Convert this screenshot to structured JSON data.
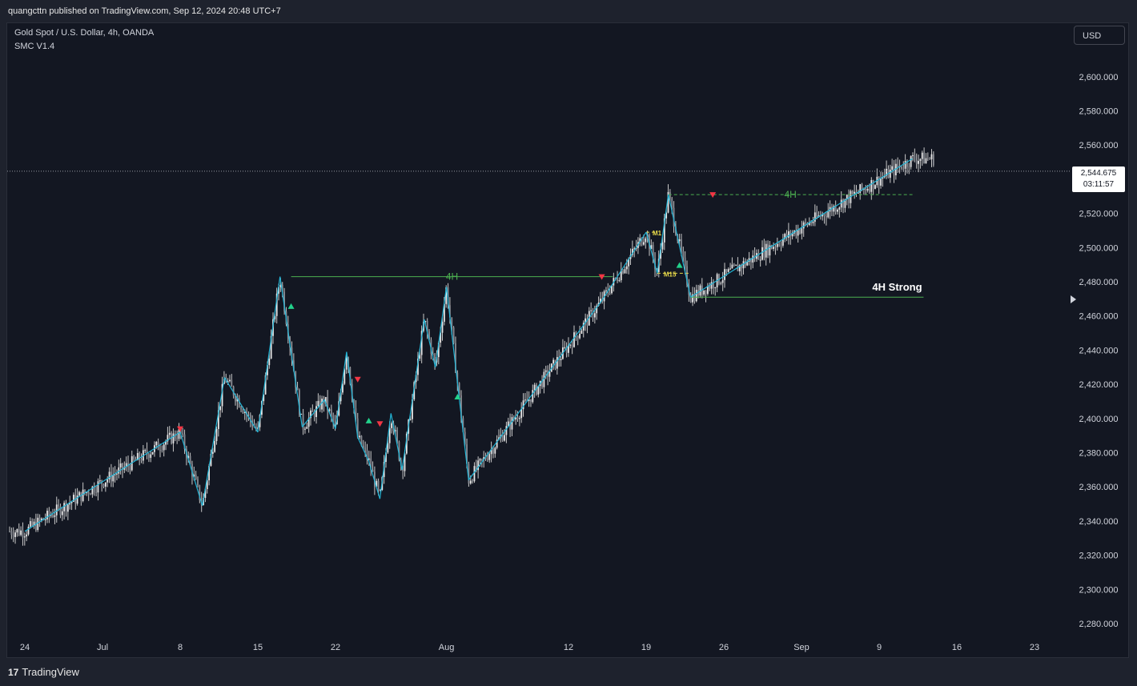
{
  "header": {
    "published": "quangcttn published on TradingView.com, Sep 12, 2024 20:48 UTC+7"
  },
  "legend": {
    "symbol": "Gold Spot / U.S. Dollar, 4h, OANDA",
    "indicator": "SMC V1.4"
  },
  "currency_button": "USD",
  "last_price": {
    "value": "2,544.675",
    "countdown": "03:11:57"
  },
  "footer": {
    "brand": "TradingView"
  },
  "colors": {
    "background": "#131722",
    "candle": "#c8c8c8",
    "zigzag": "#22b5d6",
    "level": "#4caf50",
    "bear_marker": "#f23645",
    "bull_marker": "#22d18b",
    "label_yellow": "#e6d84a"
  },
  "chart_data": {
    "type": "candlestick",
    "symbol": "XAUUSD",
    "timeframe": "4h",
    "ylim": [
      2270,
      2625
    ],
    "y_ticks": [
      2280,
      2300,
      2320,
      2340,
      2360,
      2380,
      2400,
      2420,
      2440,
      2460,
      2480,
      2500,
      2520,
      2540,
      2560,
      2580,
      2600
    ],
    "y_tick_labels": [
      "2,280.000",
      "2,300.000",
      "2,320.000",
      "2,340.000",
      "2,360.000",
      "2,380.000",
      "2,400.000",
      "2,420.000",
      "2,440.000",
      "2,460.000",
      "2,480.000",
      "2,500.000",
      "2,520.000",
      "2,540.000",
      "2,560.000",
      "2,580.000",
      "2,600.000"
    ],
    "x_axis": [
      "24",
      "Jul",
      "8",
      "15",
      "22",
      "Aug",
      "12",
      "19",
      "26",
      "Sep",
      "9",
      "16",
      "23"
    ],
    "x_axis_dates": [
      "2024-06-24",
      "2024-07-01",
      "2024-07-08",
      "2024-07-15",
      "2024-07-22",
      "2024-08-01",
      "2024-08-12",
      "2024-08-19",
      "2024-08-26",
      "2024-09-02",
      "2024-09-09",
      "2024-09-16",
      "2024-09-23"
    ],
    "last_price": 2544.675,
    "swing_path": [
      {
        "date": "2024-06-24",
        "price": 2334
      },
      {
        "date": "2024-07-08",
        "price": 2392
      },
      {
        "date": "2024-07-10",
        "price": 2349
      },
      {
        "date": "2024-07-12",
        "price": 2424
      },
      {
        "date": "2024-07-15",
        "price": 2392
      },
      {
        "date": "2024-07-17",
        "price": 2483
      },
      {
        "date": "2024-07-19",
        "price": 2395
      },
      {
        "date": "2024-07-21",
        "price": 2411
      },
      {
        "date": "2024-07-22",
        "price": 2394
      },
      {
        "date": "2024-07-23",
        "price": 2439
      },
      {
        "date": "2024-07-24",
        "price": 2389
      },
      {
        "date": "2024-07-25",
        "price": 2375
      },
      {
        "date": "2024-07-26",
        "price": 2353
      },
      {
        "date": "2024-07-27",
        "price": 2403
      },
      {
        "date": "2024-07-28",
        "price": 2370
      },
      {
        "date": "2024-07-30",
        "price": 2458
      },
      {
        "date": "2024-07-31",
        "price": 2430
      },
      {
        "date": "2024-08-01",
        "price": 2477
      },
      {
        "date": "2024-08-03",
        "price": 2364
      },
      {
        "date": "2024-08-15",
        "price": 2469
      },
      {
        "date": "2024-08-19",
        "price": 2509
      },
      {
        "date": "2024-08-20",
        "price": 2485
      },
      {
        "date": "2024-08-21",
        "price": 2531
      },
      {
        "date": "2024-08-23",
        "price": 2471
      },
      {
        "date": "2024-09-06",
        "price": 2528
      },
      {
        "date": "2024-09-12",
        "price": 2552
      }
    ],
    "levels": [
      {
        "label": "4H",
        "price": 2483,
        "from": "2024-07-18",
        "to": "2024-08-16",
        "style": "solid"
      },
      {
        "label": "4H",
        "price": 2531,
        "from": "2024-08-21",
        "to": "2024-09-12",
        "style": "dashed"
      },
      {
        "label": "4H Strong",
        "price": 2471,
        "from": "2024-08-23",
        "to": "2024-09-13",
        "style": "solid"
      },
      {
        "label": "M15",
        "price": 2485,
        "from": "2024-08-20",
        "to": "2024-08-23",
        "style": "dashed"
      },
      {
        "label": "M1",
        "price": 2509,
        "from": "2024-08-19",
        "to": "2024-08-20",
        "style": "dashed"
      }
    ],
    "markers": [
      {
        "type": "bear",
        "date": "2024-07-08",
        "price": 2394
      },
      {
        "type": "bull",
        "date": "2024-07-18",
        "price": 2466
      },
      {
        "type": "bear",
        "date": "2024-07-24",
        "price": 2423
      },
      {
        "type": "bull",
        "date": "2024-07-25",
        "price": 2399
      },
      {
        "type": "bear",
        "date": "2024-07-26",
        "price": 2397
      },
      {
        "type": "bull",
        "date": "2024-08-02",
        "price": 2413
      },
      {
        "type": "bear",
        "date": "2024-08-15",
        "price": 2483
      },
      {
        "type": "bull",
        "date": "2024-08-22",
        "price": 2490
      },
      {
        "type": "bear",
        "date": "2024-08-25",
        "price": 2531
      }
    ],
    "grid": false
  }
}
